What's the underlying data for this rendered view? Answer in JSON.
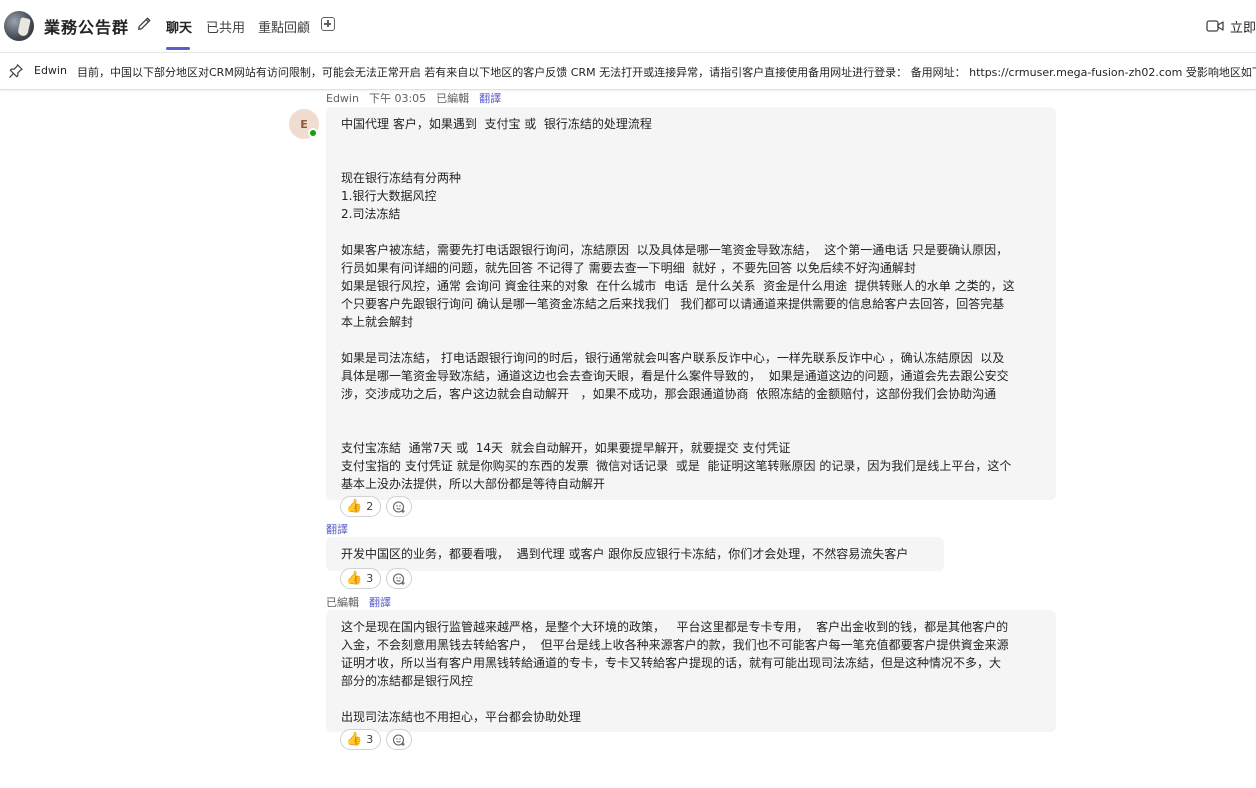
{
  "header": {
    "title": "業務公告群",
    "tabs": [
      {
        "label": "聊天"
      },
      {
        "label": "已共用"
      },
      {
        "label": "重點回顧"
      }
    ],
    "meet_label": "立即"
  },
  "pinned": {
    "author": "Edwin",
    "text": "目前，中国以下部分地区对CRM网站有访问限制，可能会无法正常开启 若有来自以下地区的客户反馈 CRM 无法打开或连接异常，请指引客户直接使用备用网址进行登录： 备用网址： https://crmuser.mega-fusion-zh02.com 受影响地区如下：• 电信"
  },
  "messages": [
    {
      "avatar_initial": "E",
      "meta": {
        "author": "Edwin",
        "time": "下午 03:05",
        "edited": "已編輯",
        "translate": "翻譯"
      },
      "lines": [
        "中国代理 客户，如果遇到  支付宝 或  银行冻结的处理流程",
        "",
        "",
        "现在银行冻结有分两种",
        "1.银行大数据风控",
        "2.司法冻結",
        "",
        "如果客户被冻結，需要先打电话跟银行询问，冻結原因  以及具体是哪一笔资金导致冻結，  这个第一通电话 只是要确认原因，",
        "行员如果有问详細的问题，就先回答 不记得了 需要去查一下明细  就好 ，不要先回答 以免后续不好沟通解封",
        "如果是银行风控，通常 会询问 資金往来的对象  在什么城市  电话  是什么关系  资金是什么用途  提供转账人的水单 之类的，这",
        "个只要客户先跟银行询问 确认是哪一笔资金冻結之后来找我们   我们都可以请通道来提供需要的信息給客户去回答，回答完基",
        "本上就会解封",
        "",
        "如果是司法冻結， 打电话跟银行询问的时后，银行通常就会叫客户联系反诈中心，一样先联系反诈中心 ，确认冻結原因  以及",
        "具体是哪一笔资金导致冻結，通道这边也会去查询天眼，看是什么案件导致的，  如果是通道这边的问题，通道会先去跟公安交",
        "涉，交涉成功之后，客户这边就会自动解开   ，如果不成功，那会跟通道协商  依照冻結的金额赔付，这部份我们会协助沟通",
        "",
        "",
        "支付宝冻結  通常7天 或  14天  就会自动解开，如果要提早解开，就要提交 支付凭证",
        "支付宝指的 支付凭证 就是你购买的东西的发票  微信对话记录  或是  能证明这笔转账原因 的记录，因为我们是线上平台，这个",
        "基本上没办法提供，所以大部份都是等待自动解开"
      ],
      "reaction": {
        "emoji": "👍",
        "count": "2"
      }
    },
    {
      "translate": "翻譯",
      "lines": [
        "开发中国区的业务，都要看哦，  遇到代理 或客户 跟你反应银行卡冻結，你们才会处理，不然容易流失客户"
      ],
      "reaction": {
        "emoji": "👍",
        "count": "3"
      }
    },
    {
      "meta": {
        "edited": "已編輯",
        "translate": "翻譯"
      },
      "lines": [
        "这个是现在国内银行监管越来越严格，是整个大环境的政策，   平台这里都是专卡专用，  客户出金收到的钱，都是其他客户的",
        "入金，不会刻意用黑钱去转給客户，  但平台是线上收各种来源客户的款，我们也不可能客户每一笔充值都要客户提供資金来源",
        "证明才收，所以当有客户用黑钱转給通道的专卡，专卡又转給客户提现的话，就有可能出现司法冻結，但是这种情况不多，大",
        "部分的冻結都是银行风控",
        "",
        "出现司法冻結也不用担心，平台都会协助处理"
      ],
      "reaction": {
        "emoji": "👍",
        "count": "3"
      }
    }
  ],
  "colors": {
    "accent": "#5b5fc7",
    "bubble": "#f5f5f5",
    "presence": "#13a10e"
  },
  "icons": [
    "edit-icon",
    "add-tab-icon",
    "video-camera-icon",
    "pin-icon",
    "add-reaction-icon",
    "thumbs-up-icon"
  ]
}
